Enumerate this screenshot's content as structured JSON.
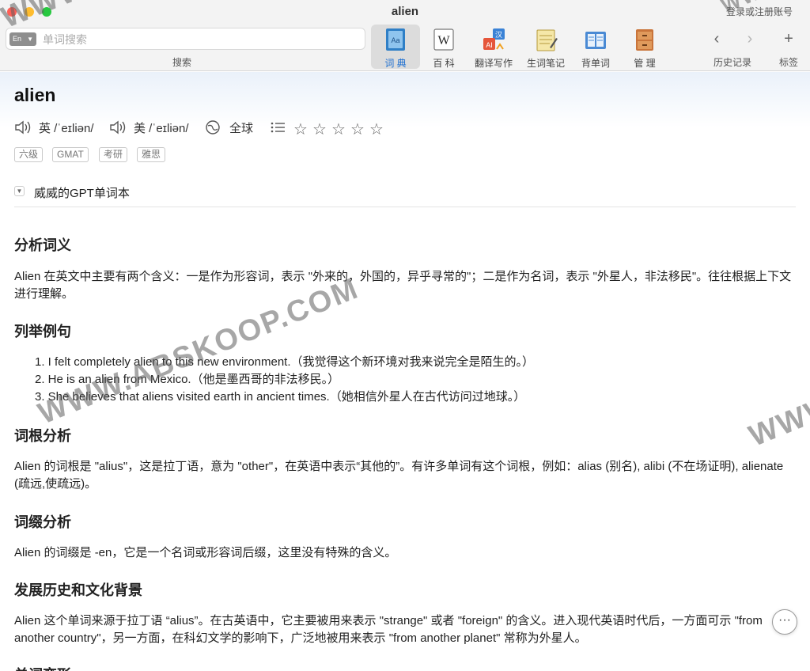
{
  "window": {
    "title": "alien",
    "login_text": "登录或注册账号"
  },
  "search": {
    "placeholder": "单词搜索",
    "caption": "搜索",
    "mode_label": "En"
  },
  "toolbar": {
    "tools": [
      {
        "label": "词 典",
        "icon": "dictionary-icon",
        "active": true
      },
      {
        "label": "百 科",
        "icon": "wikipedia-icon"
      },
      {
        "label": "翻译写作",
        "icon": "translate-icon"
      },
      {
        "label": "生词笔记",
        "icon": "notebook-icon"
      },
      {
        "label": "背单词",
        "icon": "flashcards-icon"
      },
      {
        "label": "管 理",
        "icon": "cabinet-icon"
      }
    ],
    "history_label": "历史记录",
    "bookmark_label": "标签"
  },
  "entry": {
    "word": "alien",
    "pron_uk": "英 /ˈeɪliən/",
    "pron_us": "美 /ˈeɪliən/",
    "global_label": "全球",
    "rating": 0,
    "rating_max": 5,
    "tags": [
      "六级",
      "GMAT",
      "考研",
      "雅思"
    ],
    "wordbook": "威威的GPT单词本"
  },
  "sections": {
    "meaning_title": "分析词义",
    "meaning_text": "Alien 在英文中主要有两个含义：一是作为形容词，表示 \"外来的，外国的，异乎寻常的\"；二是作为名词，表示 \"外星人，非法移民\"。往往根据上下文进行理解。",
    "examples_title": "列举例句",
    "examples": [
      "1.  I felt completely alien to this new environment.（我觉得这个新环境对我来说完全是陌生的。）",
      "2.  He is an alien from Mexico.（他是墨西哥的非法移民。）",
      "3.  She believes that aliens visited earth in ancient times.（她相信外星人在古代访问过地球。）"
    ],
    "root_title": "词根分析",
    "root_text": "Alien 的词根是 \"alius\"，这是拉丁语，意为 \"other\"，在英语中表示“其他的”。有许多单词有这个词根，例如：alias (别名), alibi (不在场证明), alienate (疏远,使疏远)。",
    "affix_title": "词缀分析",
    "affix_text": "Alien 的词缀是 -en，它是一个名词或形容词后缀，这里没有特殊的含义。",
    "history_title": "发展历史和文化背景",
    "history_text": "Alien 这个单词来源于拉丁语 “alius”。在古英语中，它主要被用来表示 \"strange\" 或者 \"foreign\" 的含义。进入现代英语时代后，一方面可示 \"from another country\"，另一方面，在科幻文学的影响下，广泛地被用来表示 \"from another planet\" 常称为外星人。",
    "next_title": "单词变形"
  },
  "watermarks": [
    "WWW.ABSKOOP.COM",
    "WWW",
    "WWW",
    "WWW"
  ]
}
